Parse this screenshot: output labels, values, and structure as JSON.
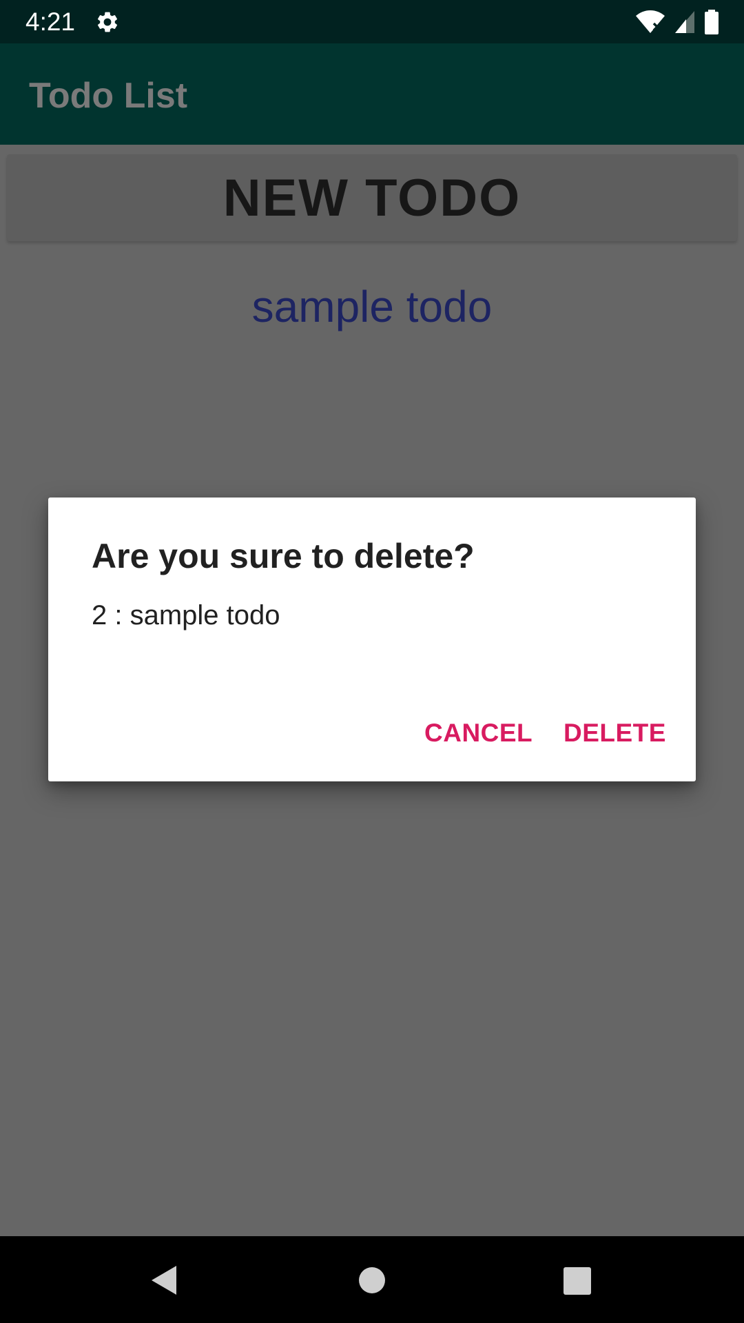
{
  "status_bar": {
    "time": "4:21",
    "icons": [
      "settings-gear-icon",
      "wifi-off-icon",
      "signal-icon",
      "battery-icon"
    ]
  },
  "app_bar": {
    "title": "Todo List"
  },
  "main": {
    "new_todo_label": "NEW TODO",
    "todos": [
      {
        "text": "sample todo"
      }
    ]
  },
  "dialog": {
    "title": "Are you sure to delete?",
    "message": "2 : sample todo",
    "cancel_label": "CANCEL",
    "delete_label": "DELETE"
  },
  "nav_bar": {
    "icons": [
      "back-icon",
      "home-icon",
      "recents-icon"
    ]
  },
  "colors": {
    "status_bar": "#012220",
    "app_bar": "#01342f",
    "scrim_background": "#666666",
    "todo_text": "#1d2462",
    "dialog_action": "#d81b60"
  }
}
